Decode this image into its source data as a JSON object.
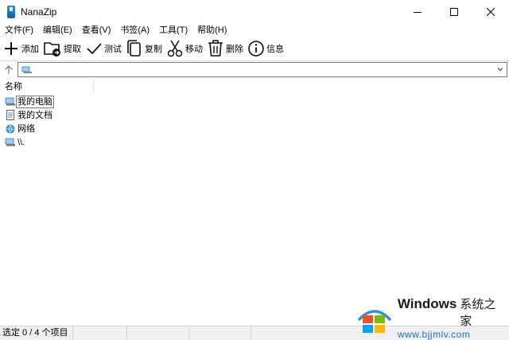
{
  "window": {
    "title": "NanaZip"
  },
  "menu": [
    {
      "label": "文件(F)"
    },
    {
      "label": "编辑(E)"
    },
    {
      "label": "查看(V)"
    },
    {
      "label": "书签(A)"
    },
    {
      "label": "工具(T)"
    },
    {
      "label": "帮助(H)"
    }
  ],
  "toolbar": [
    {
      "label": "添加",
      "icon": "plus-icon"
    },
    {
      "label": "提取",
      "icon": "extract-folder-icon"
    },
    {
      "label": "测试",
      "icon": "checkmark-icon"
    },
    {
      "label": "复制",
      "icon": "copy-icon"
    },
    {
      "label": "移动",
      "icon": "scissors-icon"
    },
    {
      "label": "删除",
      "icon": "trash-icon"
    },
    {
      "label": "信息",
      "icon": "info-icon"
    }
  ],
  "address": {
    "value": "",
    "icon": "computer-icon"
  },
  "list": {
    "columns": [
      {
        "label": "名称"
      }
    ],
    "rows": [
      {
        "label": "我的电脑",
        "icon": "computer-icon",
        "focused": true
      },
      {
        "label": "我的文档",
        "icon": "document-icon",
        "focused": false
      },
      {
        "label": "网络",
        "icon": "network-icon",
        "focused": false
      },
      {
        "label": "\\\\.",
        "icon": "computer-icon",
        "focused": false
      }
    ]
  },
  "status": {
    "text": "选定 0 / 4 个项目"
  },
  "watermark": {
    "brand": "Windows",
    "subtitle": "系统之家",
    "url": "www.bjjmlv.com"
  },
  "colors": {
    "accent": "#1d6fd8",
    "status_bg": "#f0f0f0"
  }
}
